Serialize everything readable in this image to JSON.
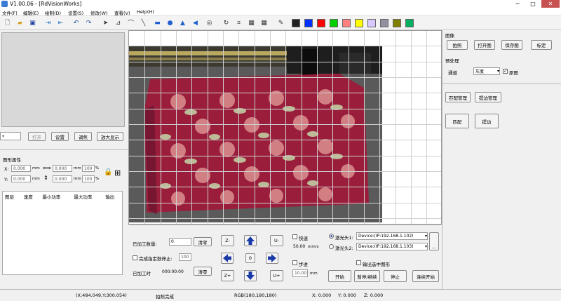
{
  "window": {
    "title": "V1.00.06 - [RdVisionWorks]",
    "minimize": "─",
    "maximize": "□",
    "close": "✕"
  },
  "menu": [
    "文件(F)",
    "编辑(E)",
    "绘制(D)",
    "设置(S)",
    "修改(W)",
    "查看(V)",
    "Help(H)"
  ],
  "toolbar": {
    "icons": [
      "new-file-icon",
      "open-folder-icon",
      "save-icon",
      "import-icon",
      "export-icon",
      "undo-icon",
      "redo-icon",
      "select-arrow-icon",
      "node-edit-icon",
      "curve-icon",
      "line-icon",
      "rectangle-icon",
      "ellipse-icon",
      "triangle-icon",
      "left-triangle-icon",
      "spiral-icon",
      "lasso-icon",
      "crop-icon",
      "grid-icon",
      "eyedropper-icon"
    ],
    "colors": [
      "#202020",
      "#0030ff",
      "#ff0000",
      "#00d000",
      "#ff8080",
      "#ffff00",
      "#d8c8ff",
      "#9090a0",
      "#808000",
      "#00b060"
    ]
  },
  "left": {
    "open": "打开",
    "settings": "设置",
    "adjust": "调焦",
    "magnify": "放大显示",
    "shape_props": "图形属性",
    "x_label": "X:",
    "y_label": "Y:",
    "x_val": "0.000",
    "y_val": "0.000",
    "w_val": "0.000",
    "h_val": "0.000",
    "w_pct": "100",
    "h_pct": "100",
    "mm": "mm",
    "pct": "%",
    "table_headers": [
      "图层",
      "速度",
      "最小功率",
      "最大功率",
      "输出"
    ]
  },
  "right": {
    "image_group": "图像",
    "capture": "拍照",
    "open_image": "打开图",
    "save_image": "保存图",
    "calibrate": "标定",
    "preprocess": "预处理",
    "channel_label": "通道",
    "channel_value": "灰度",
    "original_label": "原图",
    "match_manage": "匹配管理",
    "edge_manage": "提边管理",
    "match": "匹配",
    "edge": "提边"
  },
  "bottom": {
    "processed_count_label": "已加工数量:",
    "processed_count": "0",
    "clear": "清零",
    "stop_after_label": "完成指定数停止:",
    "stop_after_val": "100",
    "processed_time_label": "已加工时",
    "processed_time": "000:00:00",
    "clear2": "清零",
    "z_minus": "Z-",
    "z_plus": "Z+",
    "u_minus": "U-",
    "u_plus": "U+",
    "center": "0",
    "fast_label": "快速",
    "speed_val": "50.00",
    "speed_unit": "mm/s",
    "step_label": "步进",
    "step_val": "10.00",
    "step_unit": "mm",
    "laser1_label": "激光头1:",
    "laser1_device": "Device:(IP:192.168.1.102)",
    "laser2_label": "激光头2:",
    "laser2_device": "Device:(IP:192.168.1.103)",
    "output_selected": "输出选中图形",
    "start": "开始",
    "pause": "暂停/继续",
    "stop": "停止",
    "continuous": "连续开始",
    "more": "..."
  },
  "status": {
    "coords": "(X:484.049,Y:300.054)",
    "msg": "拍照完成",
    "rgb": "RGB(180,180,180)",
    "x": "X: 0.000",
    "y": "Y: 0.000",
    "z": "Z: 0.000"
  }
}
